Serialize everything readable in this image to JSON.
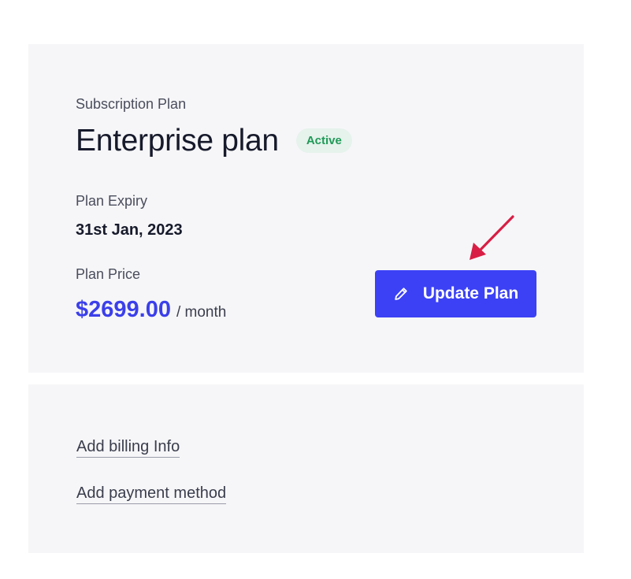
{
  "plan_card": {
    "section_label": "Subscription Plan",
    "plan_name": "Enterprise plan",
    "status_badge": "Active",
    "expiry_label": "Plan Expiry",
    "expiry_value": "31st Jan, 2023",
    "price_label": "Plan Price",
    "price_amount": "$2699.00",
    "price_period": "/ month",
    "update_button_label": "Update Plan",
    "update_button_icon": "pencil-icon"
  },
  "billing_card": {
    "links": [
      {
        "label": "Add billing Info"
      },
      {
        "label": "Add payment method"
      }
    ]
  },
  "colors": {
    "accent": "#3c41f5",
    "price": "#3b3fea",
    "status_text": "#1f9a57",
    "status_bg": "#e6f2ec",
    "card_bg": "#f6f6f8",
    "annotation_arrow": "#d81e44"
  }
}
